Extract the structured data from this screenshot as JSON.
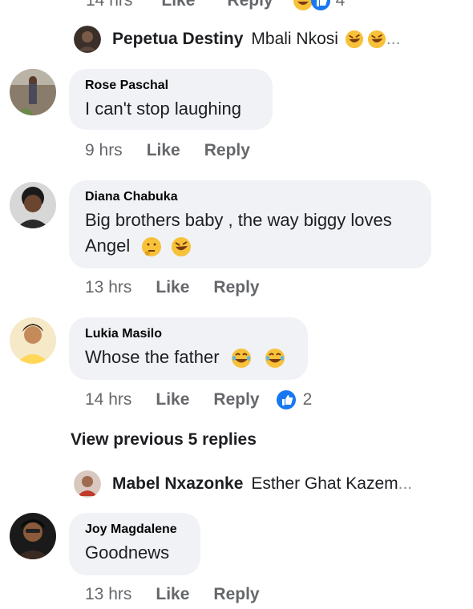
{
  "top_row": {
    "time": "14 hrs",
    "like": "Like",
    "reply": "Reply",
    "reaction_count": "4"
  },
  "preview_1": {
    "name": "Pepetua Destiny",
    "text": "Mbali Nkosi",
    "ellipsis": "..."
  },
  "comments": [
    {
      "author": "Rose Paschal",
      "text": "I can't stop laughing",
      "time": "9 hrs",
      "like": "Like",
      "reply": "Reply"
    },
    {
      "author": "Diana Chabuka",
      "text_line1": "Big brothers baby , the way biggy loves",
      "text_line2": "Angel",
      "time": "13 hrs",
      "like": "Like",
      "reply": "Reply"
    },
    {
      "author": "Lukia Masilo",
      "text": "Whose the father",
      "time": "14 hrs",
      "like": "Like",
      "reply": "Reply",
      "reaction_count": "2"
    },
    {
      "author": "Joy Magdalene",
      "text": "Goodnews",
      "time": "13 hrs",
      "like": "Like",
      "reply": "Reply"
    }
  ],
  "view_previous": "View previous 5 replies",
  "preview_2": {
    "name": "Mabel Nxazonke",
    "text": "Esther Ghat Kazem",
    "ellipsis": "..."
  },
  "colors": {
    "bubble": "#f0f2f5",
    "meta": "#65676b",
    "like_blue": "#1877f2",
    "emoji_yellow": "#f7c23a"
  }
}
